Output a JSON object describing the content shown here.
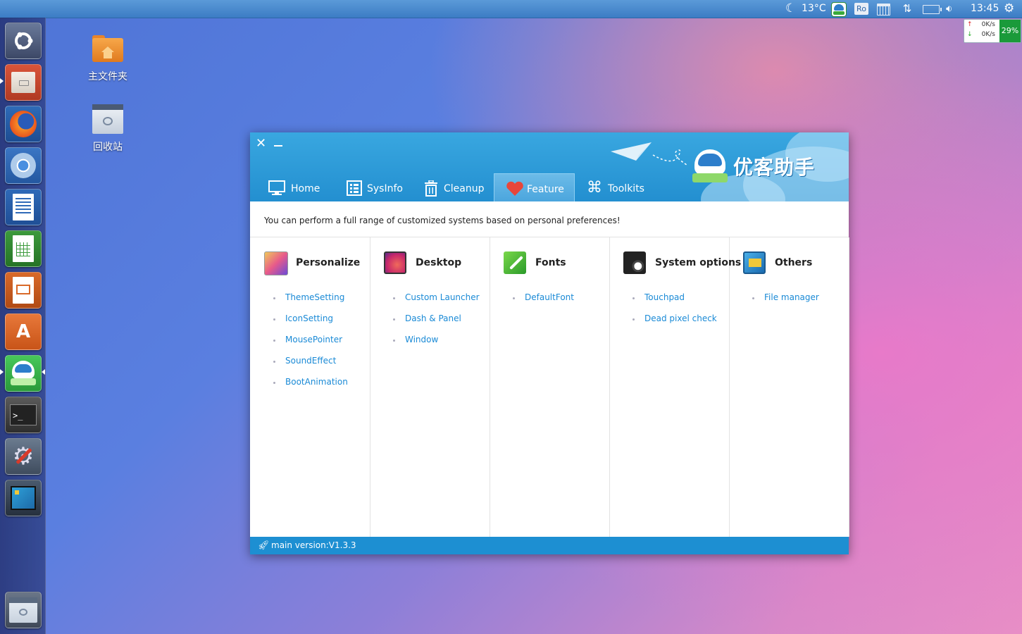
{
  "top_panel": {
    "weather_temp": "13°C",
    "ro_label": "Ro",
    "clock": "13:45",
    "net_up": "0K/s",
    "net_down": "0K/s",
    "net_percent": "29%"
  },
  "launcher": {
    "items": [
      {
        "name": "ubuntu-dash",
        "icon": "ubuntu-logo-icon"
      },
      {
        "name": "files",
        "icon": "file-cabinet-icon"
      },
      {
        "name": "firefox",
        "icon": "firefox-icon"
      },
      {
        "name": "chromium",
        "icon": "chromium-icon"
      },
      {
        "name": "writer",
        "icon": "writer-icon"
      },
      {
        "name": "calc",
        "icon": "calc-icon"
      },
      {
        "name": "impress",
        "icon": "impress-icon"
      },
      {
        "name": "software-center",
        "icon": "shopping-bag-icon"
      },
      {
        "name": "youker-assistant",
        "icon": "youker-assistant-icon"
      },
      {
        "name": "terminal",
        "icon": "terminal-icon"
      },
      {
        "name": "system-settings",
        "icon": "wrench-gear-icon"
      },
      {
        "name": "workspace-switcher",
        "icon": "workspaces-icon"
      },
      {
        "name": "trash",
        "icon": "trash-icon"
      }
    ]
  },
  "desktop": {
    "home_label": "主文件夹",
    "trash_label": "回收站"
  },
  "app": {
    "logo_text": "优客助手",
    "tabs": [
      {
        "label": "Home",
        "icon": "monitor-icon"
      },
      {
        "label": "SysInfo",
        "icon": "list-icon"
      },
      {
        "label": "Cleanup",
        "icon": "trash-can-icon"
      },
      {
        "label": "Feature",
        "icon": "heart-icon",
        "active": true
      },
      {
        "label": "Toolkits",
        "icon": "command-icon"
      }
    ],
    "description": "You can perform a full range of customized systems based on personal preferences!",
    "columns": [
      {
        "title": "Personalize",
        "items": [
          "ThemeSetting",
          "IconSetting",
          "MousePointer",
          "SoundEffect",
          "BootAnimation"
        ]
      },
      {
        "title": "Desktop",
        "items": [
          "Custom Launcher",
          "Dash & Panel",
          "Window"
        ]
      },
      {
        "title": "Fonts",
        "items": [
          "DefaultFont"
        ]
      },
      {
        "title": "System options",
        "items": [
          "Touchpad",
          "Dead pixel check"
        ]
      },
      {
        "title": "Others",
        "items": [
          "File manager"
        ]
      }
    ],
    "status": "main version:V1.3.3",
    "accent_color": "#1d8fd2",
    "link_color": "#1a8ad6"
  }
}
